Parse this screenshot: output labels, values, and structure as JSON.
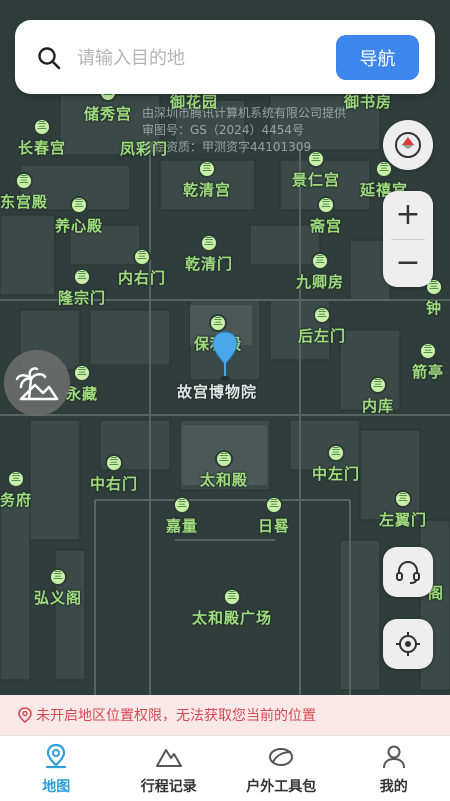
{
  "search": {
    "placeholder": "请输入目的地",
    "nav_button": "导航"
  },
  "copyright": {
    "line1": "由深圳市腾讯计算机系统有限公司提供",
    "line2": "审图号：GS（2024）4454号",
    "line3": "测绘资质：甲测资字44101309"
  },
  "pois": [
    {
      "name": "御花园"
    },
    {
      "name": "御书房"
    },
    {
      "name": "储秀宫"
    },
    {
      "name": "长春宫"
    },
    {
      "name": "凤彩门"
    },
    {
      "name": "景仁宫"
    },
    {
      "name": "延禧宫"
    },
    {
      "name": "乾清宫"
    },
    {
      "name": "东宫殿"
    },
    {
      "name": "养心殿"
    },
    {
      "name": "斋宫"
    },
    {
      "name": "乾清门"
    },
    {
      "name": "内右门"
    },
    {
      "name": "九卿房"
    },
    {
      "name": "隆宗门"
    },
    {
      "name": "钟"
    },
    {
      "name": "保和殿"
    },
    {
      "name": "后左门"
    },
    {
      "name": "永藏"
    },
    {
      "name": "箭亭"
    },
    {
      "name": "故宫博物院"
    },
    {
      "name": "内库"
    },
    {
      "name": "中右门"
    },
    {
      "name": "太和殿"
    },
    {
      "name": "中左门"
    },
    {
      "name": "务府"
    },
    {
      "name": "嘉量"
    },
    {
      "name": "日晷"
    },
    {
      "name": "左翼门"
    },
    {
      "name": "弘义阁"
    },
    {
      "name": "太和殿广场"
    },
    {
      "name": "阁"
    }
  ],
  "warning": {
    "text": "未开启地区位置权限，无法获取您当前的位置"
  },
  "tabs": [
    {
      "label": "地图",
      "icon": "map-pin-icon",
      "active": true
    },
    {
      "label": "行程记录",
      "icon": "mountain-icon",
      "active": false
    },
    {
      "label": "户外工具包",
      "icon": "leaf-icon",
      "active": false
    },
    {
      "label": "我的",
      "icon": "user-icon",
      "active": false
    }
  ],
  "controls": {
    "zoom_in": "+",
    "zoom_out": "−"
  },
  "colors": {
    "accent": "#3d86ee",
    "active_tab": "#2f9fd6",
    "poi_text": "#9fdc7d",
    "warning": "#d9484f"
  }
}
